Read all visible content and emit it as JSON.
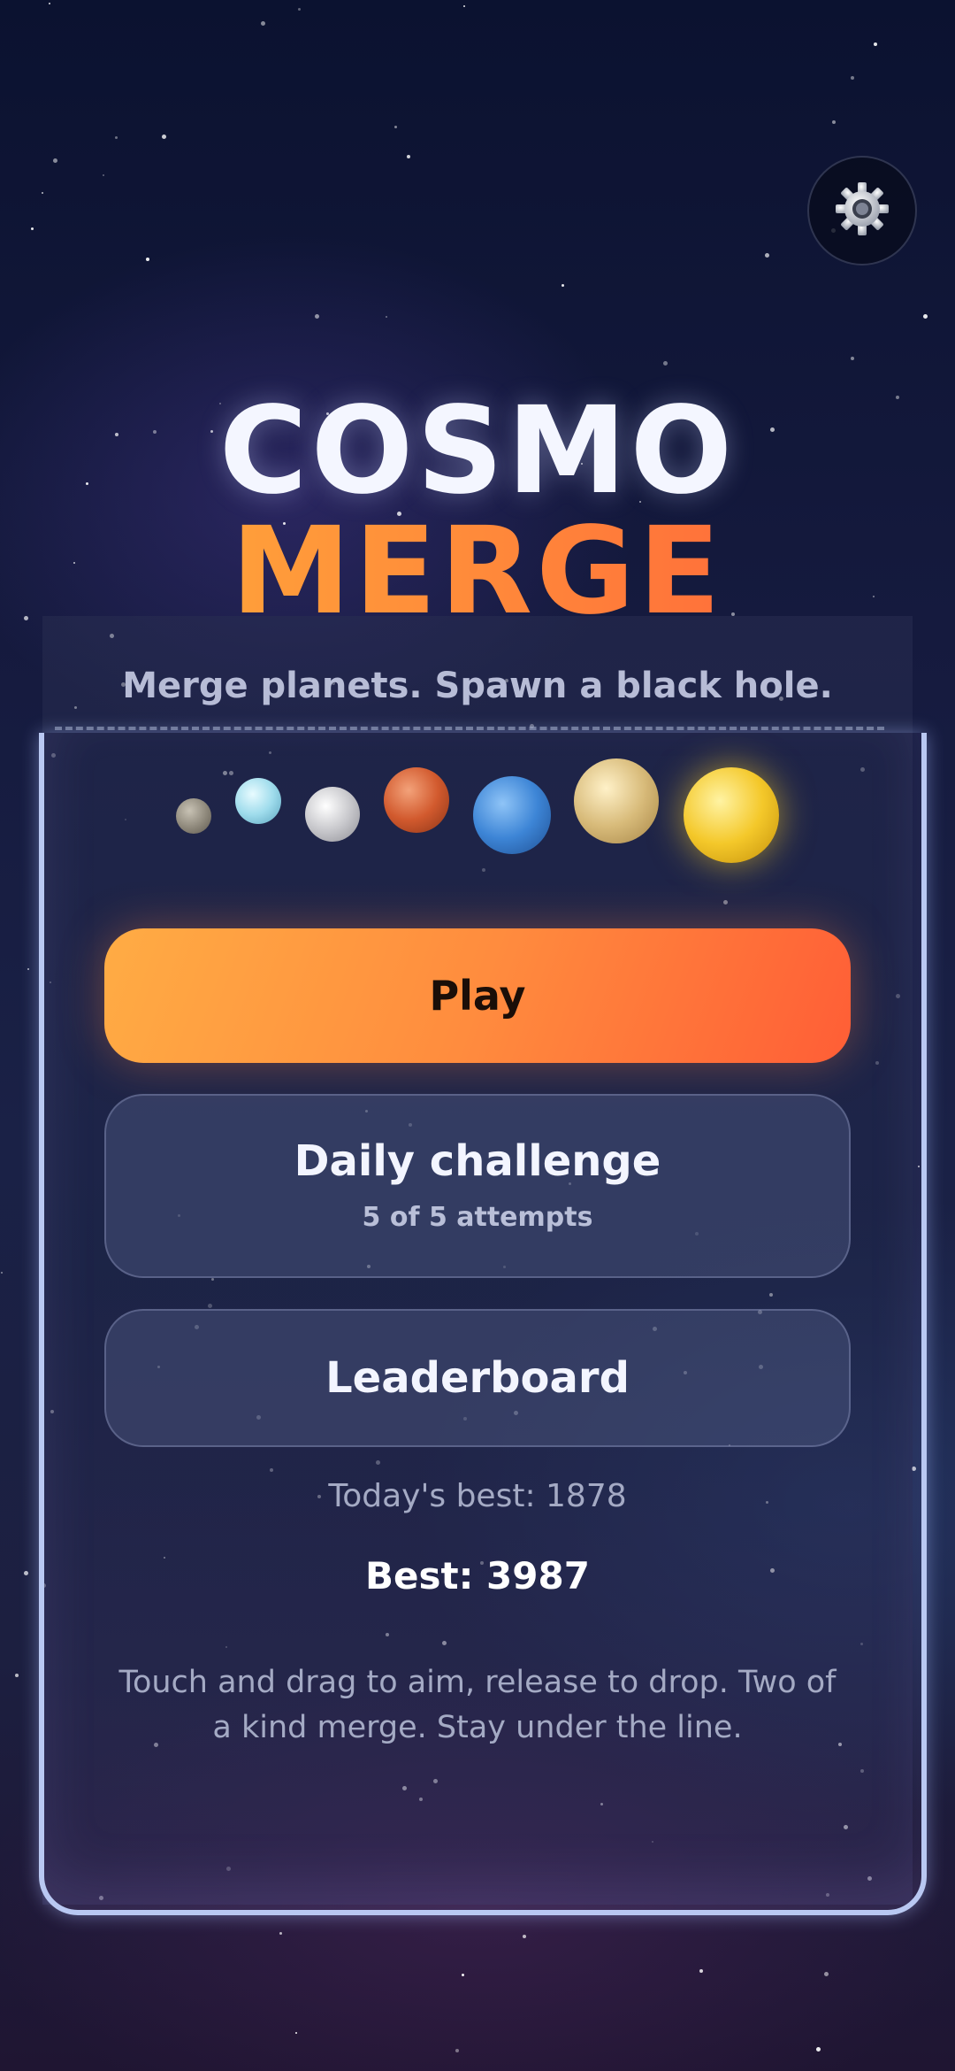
{
  "title": {
    "line1": "COSMO",
    "line2": "MERGE"
  },
  "subtitle": "Merge planets. Spawn a black hole.",
  "icons": {
    "settings": "gear-icon"
  },
  "planets": [
    "pluto",
    "uranus",
    "moon",
    "mars",
    "neptune",
    "saturn",
    "sun"
  ],
  "menu": {
    "play_label": "Play",
    "daily_label": "Daily challenge",
    "daily_attempts": "5 of 5 attempts",
    "leaderboard_label": "Leaderboard"
  },
  "scores": {
    "today": "Today's best: 1878",
    "best": "Best: 3987"
  },
  "hint": "Touch and drag to aim, release to drop. Two of a kind merge. Stay under the line.",
  "colors": {
    "accent_start": "#ffac44",
    "accent_end": "#ff5e36",
    "well_border": "#b9c8f2"
  }
}
